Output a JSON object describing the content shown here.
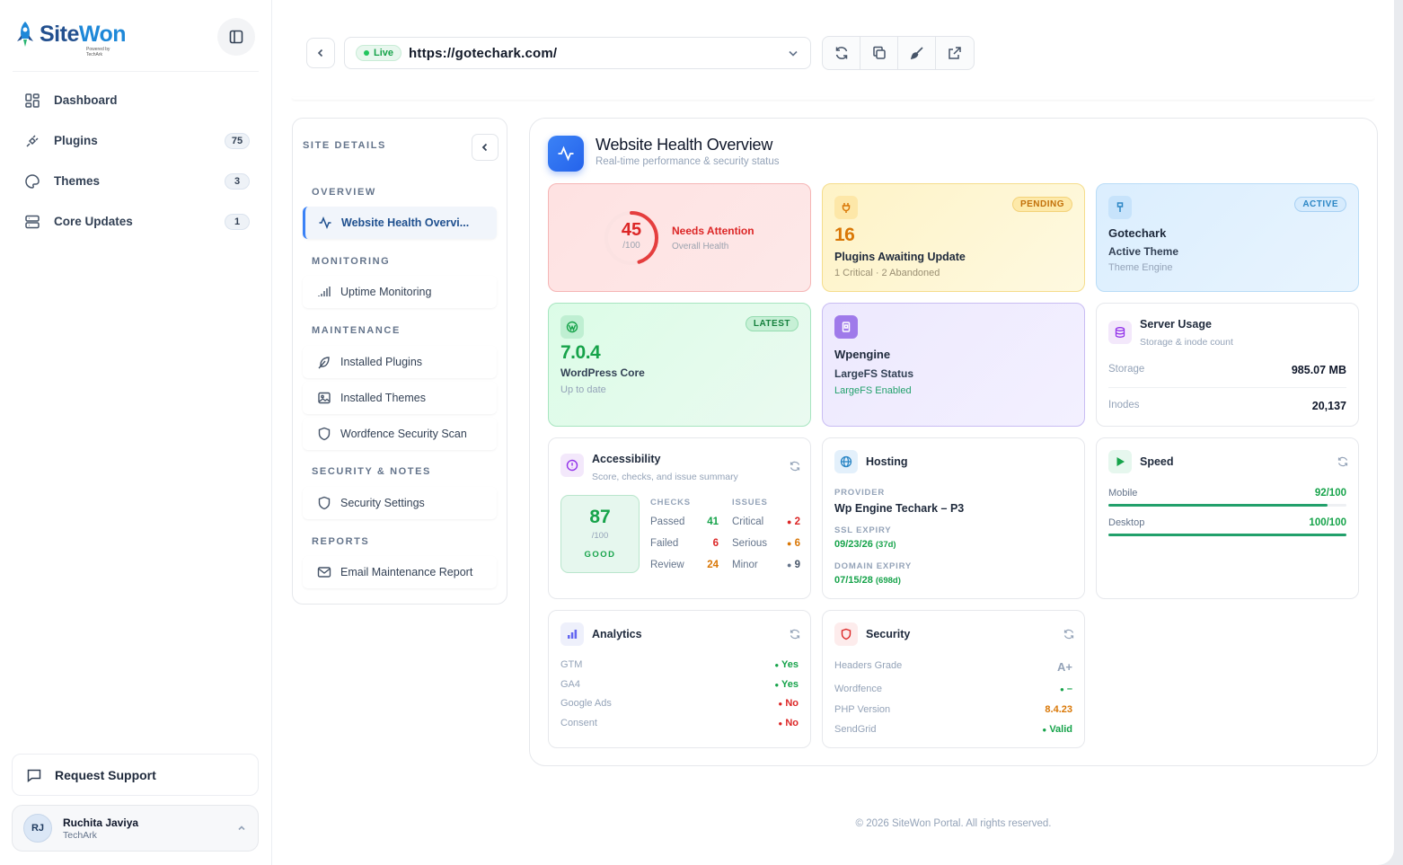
{
  "app": {
    "brand_a": "Site",
    "brand_b": "Won",
    "brand_sub": "Powered by TechArk"
  },
  "sidebar": {
    "items": [
      {
        "label": "Dashboard",
        "icon": "grid-icon",
        "count": ""
      },
      {
        "label": "Plugins",
        "icon": "plug-icon",
        "count": "75"
      },
      {
        "label": "Themes",
        "icon": "palette-icon",
        "count": "3"
      },
      {
        "label": "Core Updates",
        "icon": "server-icon",
        "count": "1"
      }
    ],
    "support_label": "Request Support",
    "user": {
      "initials": "RJ",
      "name": "Ruchita Javiya",
      "org": "TechArk"
    }
  },
  "topbar": {
    "status": "Live",
    "url": "https://gotechark.com/"
  },
  "details": {
    "title": "SITE DETAILS",
    "sections": {
      "overview": "OVERVIEW",
      "monitoring": "MONITORING",
      "maintenance": "MAINTENANCE",
      "security": "SECURITY & NOTES",
      "reports": "REPORTS"
    },
    "items": {
      "health": "Website Health Overvi...",
      "uptime": "Uptime Monitoring",
      "plugins": "Installed Plugins",
      "themes": "Installed Themes",
      "wordfence": "Wordfence Security Scan",
      "security": "Security Settings",
      "email": "Email Maintenance Report"
    }
  },
  "health": {
    "title": "Website Health Overview",
    "subtitle": "Real-time performance & security status",
    "overall": {
      "score": "45",
      "of": "/100",
      "score_value": 45,
      "status": "Needs Attention",
      "label": "Overall Health"
    },
    "plugins": {
      "badge": "PENDING",
      "count": "16",
      "title": "Plugins Awaiting Update",
      "sub": "1 Critical · 2 Abandoned"
    },
    "theme": {
      "badge": "ACTIVE",
      "name": "Gotechark",
      "title": "Active Theme",
      "sub": "Theme Engine"
    },
    "core": {
      "badge": "LATEST",
      "version": "7.0.4",
      "title": "WordPress Core",
      "sub": "Up to date"
    },
    "host": {
      "name": "Wpengine",
      "title": "LargeFS Status",
      "sub": "LargeFS Enabled"
    },
    "server": {
      "title": "Server Usage",
      "sub": "Storage & inode count",
      "storage_label": "Storage",
      "storage": "985.07 MB",
      "inodes_label": "Inodes",
      "inodes": "20,137"
    },
    "accessibility": {
      "title": "Accessibility",
      "sub": "Score, checks, and issue summary",
      "score": "87",
      "of": "/100",
      "grade": "GOOD",
      "checks_h": "CHECKS",
      "issues_h": "ISSUES",
      "checks": [
        {
          "label": "Passed",
          "value": "41"
        },
        {
          "label": "Failed",
          "value": "6"
        },
        {
          "label": "Review",
          "value": "24"
        }
      ],
      "issues": [
        {
          "label": "Critical",
          "value": "2"
        },
        {
          "label": "Serious",
          "value": "6"
        },
        {
          "label": "Minor",
          "value": "9"
        }
      ]
    },
    "hosting": {
      "title": "Hosting",
      "provider_h": "PROVIDER",
      "provider": "Wp Engine Techark – P3",
      "ssl_h": "SSL EXPIRY",
      "ssl": "09/23/26",
      "ssl_days": "(37d)",
      "domain_h": "DOMAIN EXPIRY",
      "domain": "07/15/28",
      "domain_days": "(698d)"
    },
    "speed": {
      "title": "Speed",
      "mobile_label": "Mobile",
      "mobile": "92/100",
      "mobile_pct": 92,
      "desktop_label": "Desktop",
      "desktop": "100/100",
      "desktop_pct": 100
    },
    "analytics": {
      "title": "Analytics",
      "rows": [
        {
          "label": "GTM",
          "value": "Yes"
        },
        {
          "label": "GA4",
          "value": "Yes"
        },
        {
          "label": "Google Ads",
          "value": "No"
        },
        {
          "label": "Consent",
          "value": "No"
        }
      ]
    },
    "security": {
      "title": "Security",
      "rows": [
        {
          "label": "Headers Grade",
          "value": "A+"
        },
        {
          "label": "Wordfence",
          "value": "–"
        },
        {
          "label": "PHP Version",
          "value": "8.4.23"
        },
        {
          "label": "SendGrid",
          "value": "Valid"
        }
      ]
    }
  },
  "footer": "© 2026 SiteWon Portal. All rights reserved.",
  "colors": {
    "accent": "#2563eb",
    "good": "#22a06b",
    "bad": "#dc2626",
    "warn": "#d97706"
  }
}
